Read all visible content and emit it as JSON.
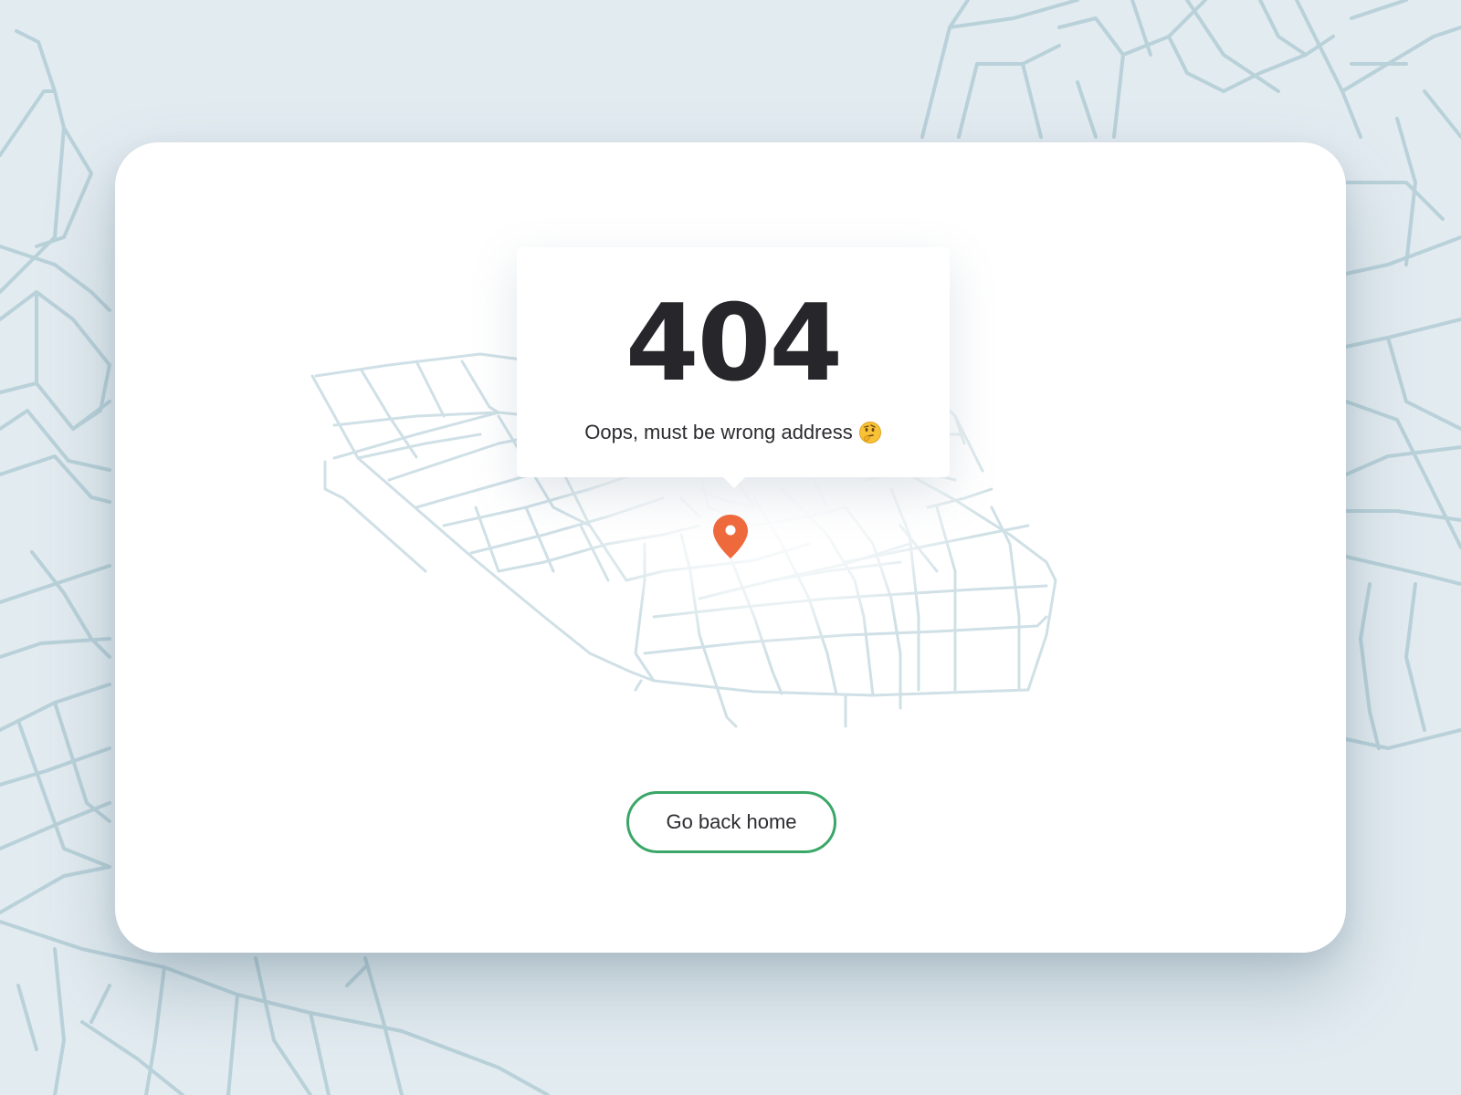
{
  "error": {
    "code": "404",
    "message": "Oops, must be wrong address",
    "emoji_icon": "thinking-face-icon"
  },
  "actions": {
    "home_button_label": "Go back home"
  },
  "map": {
    "pin_icon": "location-pin-icon",
    "pin_color": "#ee6a3c",
    "road_color": "#b9d1d9"
  },
  "colors": {
    "background": "#e2ebf0",
    "card": "#ffffff",
    "text": "#26262b",
    "button_border": "#3aa768"
  }
}
